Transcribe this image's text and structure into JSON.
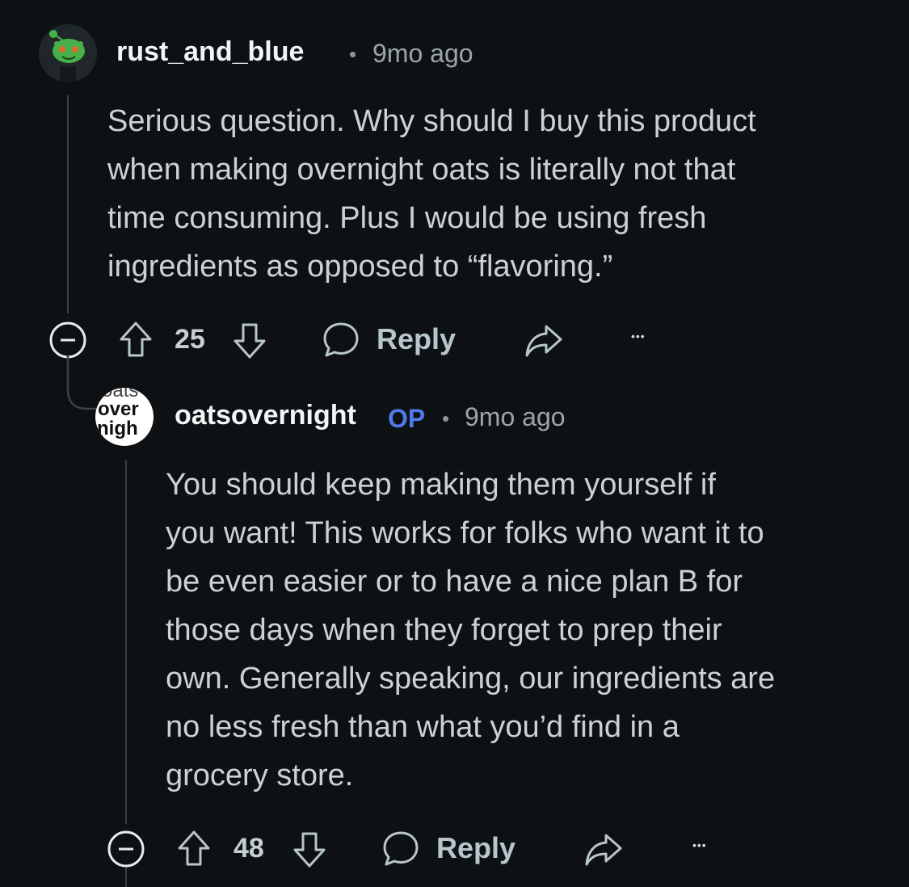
{
  "comments": [
    {
      "username": "rust_and_blue",
      "separator": "•",
      "time": "9mo ago",
      "body": "Serious question. Why should I buy this product\nwhen making overnight oats is literally not that\ntime consuming. Plus I would be using fresh\ningredients as opposed to “flavoring.”",
      "votes": "25",
      "reply_label": "Reply",
      "more_label": "•••",
      "avatar_icon": "snoo-avatar-icon"
    },
    {
      "username": "oatsovernight",
      "op_badge": "OP",
      "separator": "•",
      "time": "9mo ago",
      "body": "You should keep making them yourself if\nyou want! This works for folks who want it to\nbe even easier or to have a nice plan B for\nthose days when they forget to prep their\nown. Generally speaking, our ingredients are\nno less fresh than what you’d find in a\ngrocery store.",
      "votes": "48",
      "reply_label": "Reply",
      "more_label": "•••",
      "avatar_text": [
        "oats",
        "over",
        "nigh"
      ]
    }
  ],
  "colors": {
    "background": "#0e1113",
    "op_badge": "#4f7ae8",
    "text": "#c9d3d7"
  }
}
